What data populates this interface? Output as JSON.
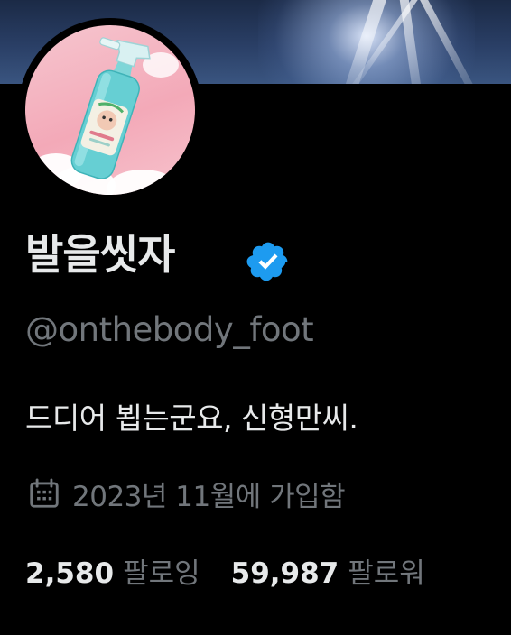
{
  "profile": {
    "display_name": "발을씻자",
    "handle": "@onthebody_foot",
    "bio": "드디어 뵙는군요, 신형만씨.",
    "joined": "2023년 11월에 가입함",
    "verified_icon": "verified-badge-icon",
    "verified_color": "#1d9bf0"
  },
  "stats": {
    "following_count": "2,580",
    "following_label": "팔로잉",
    "followers_count": "59,987",
    "followers_label": "팔로워"
  },
  "colors": {
    "background": "#000000",
    "primary_text": "#e7e9ea",
    "secondary_text": "#71767b",
    "accent": "#1d9bf0"
  }
}
